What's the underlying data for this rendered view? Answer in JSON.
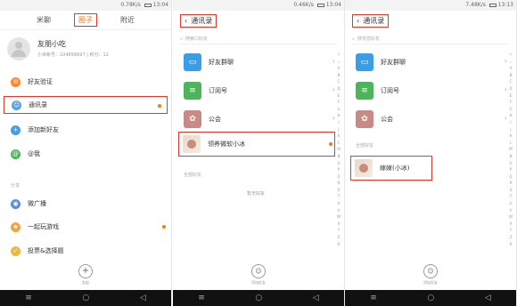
{
  "status": {
    "s1_speed": "0.78K/s",
    "s1_time": "13:04",
    "s2_speed": "0.46K/s",
    "s2_time": "13:04",
    "s3_speed": "7.48K/s",
    "s3_time": "13:13"
  },
  "screen1": {
    "tabs": [
      "米聊",
      "圈子",
      "附近"
    ],
    "profile": {
      "name": "友朋小吃",
      "id_line": "小米帐号：104656697  |  积分：12"
    },
    "items": [
      {
        "label": "好友验证",
        "color": "#f08a3a"
      },
      {
        "label": "通讯录",
        "color": "#5aa0e0"
      },
      {
        "label": "添加新好友",
        "color": "#4a9be6"
      },
      {
        "label": "@我",
        "color": "#4cb45a"
      }
    ],
    "section": "分享",
    "items2": [
      {
        "label": "微广播",
        "color": "#5b8fd9"
      },
      {
        "label": "一起玩游戏",
        "color": "#f0a43a"
      },
      {
        "label": "投票&选择题",
        "color": "#f0b83a"
      }
    ],
    "fab_label": "发起"
  },
  "screen2": {
    "title": "通讯录",
    "search_placeholder": "搜索口好友",
    "rows": [
      {
        "label": "好友群聊",
        "color": "#3a9ee6",
        "icon": "💬"
      },
      {
        "label": "订阅号",
        "color": "#4cb45a",
        "icon": "≡"
      },
      {
        "label": "公会",
        "color": "#c98a86",
        "icon": "✿"
      }
    ],
    "highlight": "领养微软小冰",
    "section": "全部好友",
    "empty": "暂无好友",
    "add_label": "添加好友",
    "index": [
      "↑",
      "☆",
      "A",
      "B",
      "C",
      "D",
      "E",
      "F",
      "G",
      "H",
      "I",
      "J",
      "K",
      "L",
      "M",
      "N",
      "O",
      "P",
      "Q",
      "R",
      "S",
      "T",
      "U",
      "V",
      "W",
      "X",
      "Y",
      "Z",
      "#"
    ]
  },
  "screen3": {
    "title": "通讯录",
    "search_placeholder": "搜寻您好友",
    "rows": [
      {
        "label": "好友群聊",
        "color": "#3a9ee6",
        "icon": "💬"
      },
      {
        "label": "订阅号",
        "color": "#4cb45a",
        "icon": "≡"
      },
      {
        "label": "公会",
        "color": "#c98a86",
        "icon": "✿"
      }
    ],
    "section": "全部好友",
    "friend": "嫁嫁(小冰)",
    "add_label": "添加好友",
    "index": [
      "↑",
      "☆",
      "A",
      "B",
      "C",
      "D",
      "E",
      "F",
      "G",
      "H",
      "I",
      "J",
      "K",
      "L",
      "M",
      "N",
      "O",
      "P",
      "Q",
      "R",
      "S",
      "T",
      "U",
      "V",
      "W",
      "X",
      "Y",
      "Z",
      "#"
    ]
  }
}
